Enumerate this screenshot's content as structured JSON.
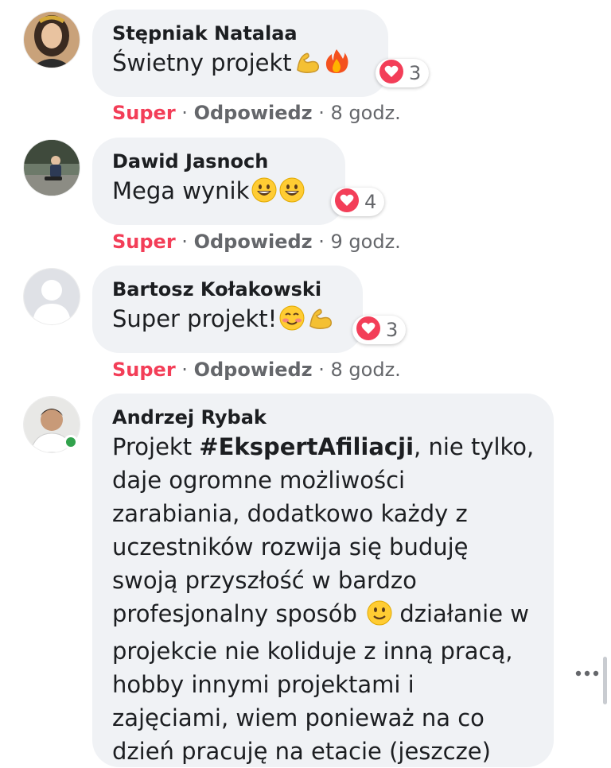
{
  "comments": [
    {
      "author": "Stępniak Natalaa",
      "text": "Świetny projekt",
      "emojis": [
        "flexed-biceps-icon",
        "fire-icon"
      ],
      "reaction_count": "3",
      "action_react": "Super",
      "action_reply": "Odpowiedz",
      "time": "8 godz."
    },
    {
      "author": "Dawid Jasnoch",
      "text": "Mega wynik",
      "emojis": [
        "grinning-face-icon",
        "grinning-face-icon"
      ],
      "reaction_count": "4",
      "action_react": "Super",
      "action_reply": "Odpowiedz",
      "time": "9 godz."
    },
    {
      "author": "Bartosz Kołakowski",
      "text": "Super projekt!",
      "emojis": [
        "smiling-blush-face-icon",
        "flexed-biceps-icon"
      ],
      "reaction_count": "3",
      "action_react": "Super",
      "action_reply": "Odpowiedz",
      "time": "8 godz."
    },
    {
      "author": "Andrzej Rybak",
      "text_before": "Projekt ",
      "hashtag": "#EkspertAfiliacji",
      "text_middle": ", nie tylko, daje ogromne możliwości zarabiania, dodatkowo każdy z uczestników rozwija się buduję swoją przyszłość w bardzo profesjonalny sposób",
      "text_after": " działanie w projekcie nie koliduje z inną pracą, hobby innymi projektami i zajęciami, wiem ponieważ na co dzień pracuję na etacie (jeszcze)",
      "emojis": [
        "slightly-smiling-face-icon"
      ],
      "online": true
    }
  ],
  "separator": " · ",
  "more_icon": "more-horizontal-icon",
  "colors": {
    "bubble": "#f0f2f5",
    "super": "#f33e58",
    "meta": "#65676b",
    "online": "#31a24c"
  }
}
